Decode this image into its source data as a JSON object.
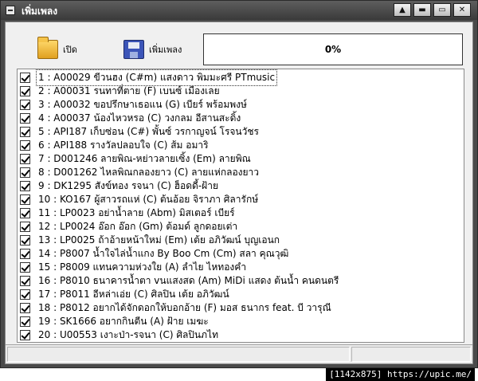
{
  "window": {
    "title": "เพิ่มเพลง",
    "controls": {
      "scroll_up": "▲",
      "scroll_down": "▬",
      "maximize": "▭",
      "close": "✕"
    }
  },
  "toolbar": {
    "open_label": "เปิด",
    "open_icon": "folder-open-icon",
    "add_label": "เพิ่มเพลง",
    "add_icon": "floppy-save-icon",
    "progress_text": "0%",
    "progress_value": 0
  },
  "songs": [
    {
      "text": "1 : A00029 ขีวนฮง (C#m) แสงดาว  พิมมะศรี PTmusic",
      "checked": true,
      "selected": true
    },
    {
      "text": "2 : A00031 รนทาที่ตาย (F) เบนซ์  เมืองเลย",
      "checked": true,
      "selected": false
    },
    {
      "text": "3 : A00032 ขอปรึกษาเธอแน (G) เบียร์  พร้อมพงษ์",
      "checked": true,
      "selected": false
    },
    {
      "text": "4 : A00037 น้องไหวหรอ (C) วงกลม อีสานสะดิ้ง",
      "checked": true,
      "selected": false
    },
    {
      "text": "5 : API187 เก็บซ่อน (C#) พั้นซ์   วรกาญจน์  โรจนวัชร",
      "checked": true,
      "selected": false
    },
    {
      "text": "6 : API188 รางวัลปลอบใจ (C) ส้ม    อมาริ",
      "checked": true,
      "selected": false
    },
    {
      "text": "7 : D001246 ลายพิณ-หย่าวลายเซิ้ง (Em) ลายพิณ",
      "checked": true,
      "selected": false
    },
    {
      "text": "8 : D001262 ไหลพิณกลองยาว (C) ลายแห่กลองยาว",
      "checked": true,
      "selected": false
    },
    {
      "text": "9 : DK1295 สังข์ทอง รจนา (C) ฮ็อดดี้-ฝ้าย",
      "checked": true,
      "selected": false
    },
    {
      "text": "10 : KO167 ผู้สาวรถแห่ (C) ต้นอ้อย จิราภา ศิลารักษ์",
      "checked": true,
      "selected": false
    },
    {
      "text": "11 : LP0023 อย่าน้ำลาย (Abm) มิสเตอร์ เบียร์",
      "checked": true,
      "selected": false
    },
    {
      "text": "12 : LP0024 อ๊อก อ๊อก  (Gm) ต้อมด์ ลูกดอยเต่า",
      "checked": true,
      "selected": false
    },
    {
      "text": "13 : LP0025 ถ้าอ้ายหน้าใหม่ (Em) เต้ย อภิวัฒน์ บุญเอนก",
      "checked": true,
      "selected": false
    },
    {
      "text": "14 : P8007 น้ำใจไล่น้ำแกง By Boo Cm (Cm) สลา คุณวุฒิ",
      "checked": true,
      "selected": false
    },
    {
      "text": "15 : P8009 แทนความห่วงใย (A) ลำไย ไหทองคำ",
      "checked": true,
      "selected": false
    },
    {
      "text": "16 : P8010 ธนาคารน้ำตา vนแสงสด (Am) MiDi แสดง ต้นน้ำ คนดนตรี",
      "checked": true,
      "selected": false
    },
    {
      "text": "17 : P8011 อีหล่าเอ่ย (C) ศิลปิน เต้ย อภิวัฒน์",
      "checked": true,
      "selected": false
    },
    {
      "text": "18 : P8012 อยากได้จักดอกให้บอกอ้าย (F) มอส ธนากร feat. บี วารุณี",
      "checked": true,
      "selected": false
    },
    {
      "text": "19 : SK1666 อยากกินตีน (A) ฝ้าย เมฆะ",
      "checked": true,
      "selected": false
    },
    {
      "text": "20 : U00553 เงาะป่า-รจนา (C) ศิลปินภไท",
      "checked": true,
      "selected": false
    }
  ],
  "watermark": "[1142x875] https://upic.me/"
}
